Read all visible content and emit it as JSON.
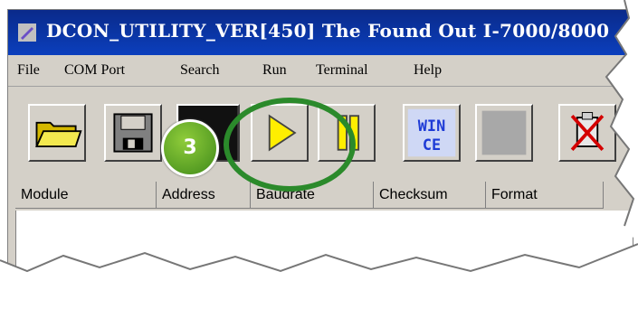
{
  "window": {
    "title": "DCON_UTILITY_VER[450] The Found Out I-7000/8000"
  },
  "menu": {
    "items": [
      {
        "label": "File"
      },
      {
        "label": "COM Port"
      },
      {
        "label": "Search"
      },
      {
        "label": "Run"
      },
      {
        "label": "Terminal"
      },
      {
        "label": "Help"
      }
    ]
  },
  "toolbar": {
    "buttons": [
      {
        "icon": "folder-open-icon"
      },
      {
        "icon": "floppy-disk-icon"
      },
      {
        "icon": "search-icon"
      },
      {
        "icon": "play-icon"
      },
      {
        "icon": "pause-icon"
      },
      {
        "icon": "wince-icon",
        "label_top": "WIN",
        "label_bottom": "CE"
      },
      {
        "icon": "blank-icon"
      },
      {
        "icon": "disconnect-icon"
      }
    ]
  },
  "table": {
    "columns": [
      "Module",
      "Address",
      "Baudrate",
      "Checksum",
      "Format"
    ]
  },
  "annotation": {
    "step_number": "3",
    "highlight_color": "#2b8a2b"
  }
}
